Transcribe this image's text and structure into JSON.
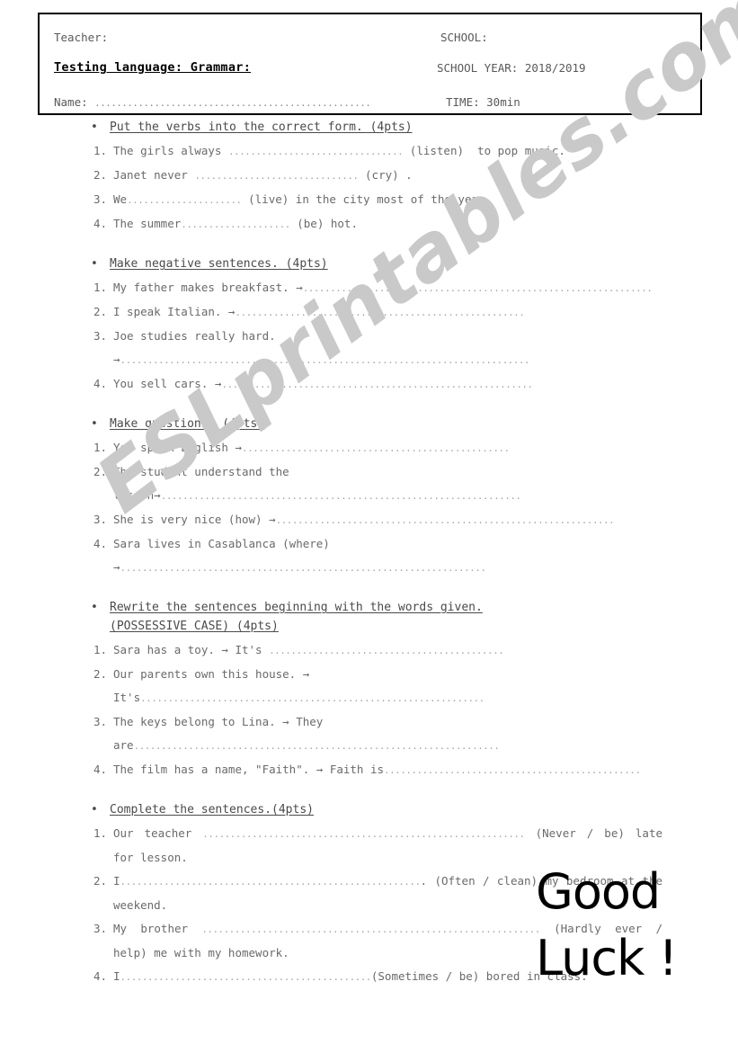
{
  "header": {
    "teacher_label": "Teacher:",
    "school_label": "SCHOOL:",
    "title": "Testing language: Grammar:",
    "school_year": "SCHOOL YEAR: 2018/2019",
    "name_label": "Name:",
    "name_dots": "...................................................",
    "time": "TIME: 30min"
  },
  "bullet_glyph": "•",
  "arrow_glyph": "→",
  "exercises": [
    {
      "heading": "Put the verbs into the correct form. (4pts)",
      "items": [
        {
          "num": "1.",
          "before": "The girls always ",
          "dots": "................................",
          "after": " (listen)  to pop music."
        },
        {
          "num": "2.",
          "before": "Janet never ",
          "dots": "..............................",
          "after": " (cry) ."
        },
        {
          "num": "3.",
          "before": "We",
          "dots": ".....................",
          "after": " (live) in the city most of the year."
        },
        {
          "num": "4.",
          "before": "The summer",
          "dots": "....................",
          "after": " (be) hot."
        }
      ]
    },
    {
      "heading": "Make negative sentences. (4pts)",
      "items": [
        {
          "num": "1.",
          "before": "My father makes breakfast. →",
          "dots": "................................................................",
          "after": ""
        },
        {
          "num": "2.",
          "before": "I speak Italian. →",
          "dots": ".....................................................",
          "after": ""
        },
        {
          "num": "3.",
          "before": "Joe studies really hard. →",
          "dots": "...........................................................................",
          "after": ""
        },
        {
          "num": "4.",
          "before": "You sell cars. →",
          "dots": ".........................................................",
          "after": ""
        }
      ]
    },
    {
      "heading": "Make questions. (4pts)",
      "items": [
        {
          "num": "1.",
          "before": "You speak English →",
          "dots": ".................................................",
          "after": ""
        },
        {
          "num": "2.",
          "before": "The student understand the lesson→",
          "dots": "..................................................................",
          "after": ""
        },
        {
          "num": "3.",
          "before": "She is very nice (how) →",
          "dots": "..............................................................",
          "after": ""
        },
        {
          "num": "4.",
          "before": "Sara lives in Casablanca (where) →",
          "dots": "...................................................................",
          "after": ""
        }
      ]
    },
    {
      "heading": "Rewrite the sentences beginning with the words given.",
      "heading_line2": "(POSSESSIVE CASE) (4pts)",
      "items": [
        {
          "num": "1.",
          "before": "Sara has a toy. → It's ",
          "dots": "...........................................",
          "after": ""
        },
        {
          "num": "2.",
          "before": "Our parents own this house. → It's",
          "dots": "...............................................................",
          "after": ""
        },
        {
          "num": "3.",
          "before": "The keys belong to Lina. → They are",
          "dots": "...................................................................",
          "after": ""
        },
        {
          "num": "4.",
          "justified": true,
          "before": "The film has a name, \"Faith\". → Faith is",
          "dots": "...............................................",
          "after": ""
        }
      ]
    },
    {
      "heading": "Complete the sentences.(4pts)",
      "items": [
        {
          "num": "1.",
          "justified": true,
          "before": "Our teacher ",
          "dots": "...........................................................",
          "after": " (Never / be) late for lesson."
        },
        {
          "num": "2.",
          "justified": true,
          "before": "I",
          "dots": ".......................................................",
          "after": ". (Often / clean) my bedroom at the weekend."
        },
        {
          "num": "3.",
          "justified": true,
          "before": "My brother ",
          "dots": "..............................................................",
          "after": " (Hardly ever / help) me with my homework."
        },
        {
          "num": "4.",
          "before": "I",
          "dots": "..............................................",
          "after": "(Sometimes / be) bored in class."
        }
      ]
    }
  ],
  "watermark": {
    "text": "ESLprintables.com",
    "color": "#c9c9c9"
  },
  "good_luck": {
    "line1": "Good",
    "line2": "Luck !"
  }
}
